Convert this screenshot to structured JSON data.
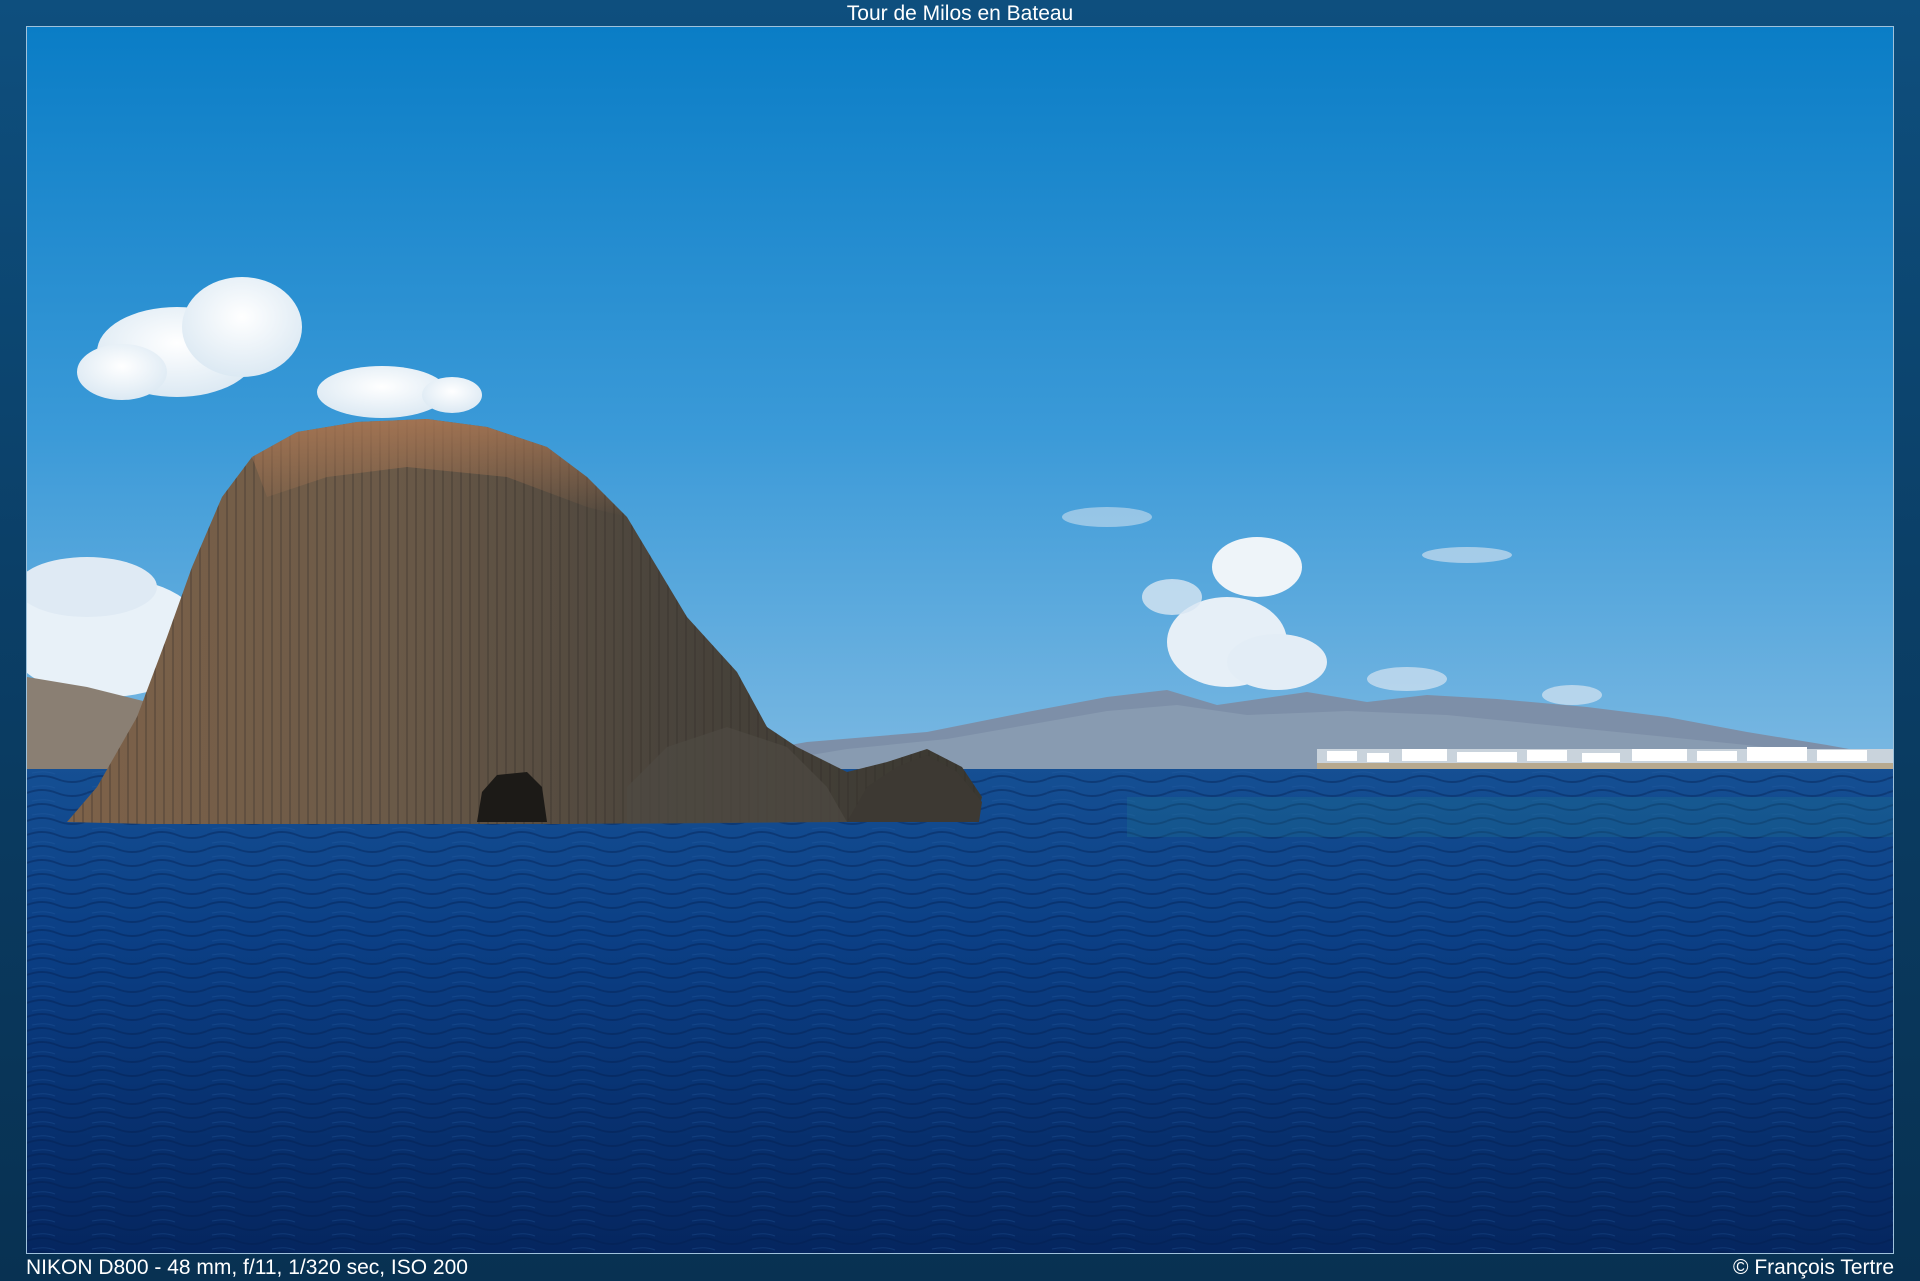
{
  "gallery": {
    "title": "Tour de Milos en Bateau",
    "exif_caption": "NIKON D800 - 48 mm, f/11, 1/320 sec, ISO 200",
    "copyright": "© François Tertre"
  },
  "photo": {
    "subject": "sea-stack-rock",
    "colors": {
      "sky_top": "#0a7fc8",
      "sky_bottom": "#6fb3e0",
      "sea_top": "#0d4a8e",
      "sea_bottom": "#062c6a",
      "rock_light": "#8c6a4f",
      "rock_dark": "#3d3a33"
    }
  }
}
